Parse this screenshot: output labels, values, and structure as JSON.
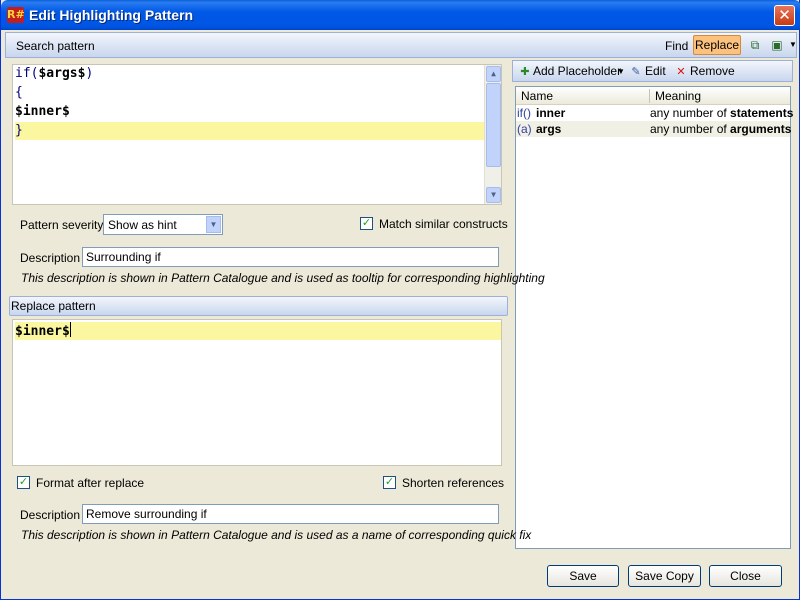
{
  "window": {
    "title": "Edit Highlighting Pattern",
    "app_icon": "R#"
  },
  "search": {
    "header_label": "Search pattern",
    "find_label": "Find",
    "replace_label": "Replace",
    "code": [
      "if($args$)",
      "{",
      "$inner$",
      "}"
    ],
    "severity_label": "Pattern severity",
    "severity_value": "Show as hint",
    "match_similar_label": "Match similar constructs",
    "description_label": "Description",
    "description_value": "Surrounding if",
    "description_hint": "This description is shown in Pattern Catalogue and is used as tooltip for corresponding highlighting"
  },
  "replace": {
    "header_label": "Replace pattern",
    "code": [
      "$inner$"
    ],
    "format_label": "Format after replace",
    "shorten_label": "Shorten references",
    "description_label": "Description",
    "description_value": "Remove surrounding if",
    "description_hint": "This description is shown in Pattern Catalogue and is used as a name of corresponding quick fix"
  },
  "placeholders": {
    "add_label": "Add Placeholder",
    "edit_label": "Edit",
    "remove_label": "Remove",
    "columns": [
      "Name",
      "Meaning"
    ],
    "rows": [
      {
        "icon": "if()",
        "name": "inner",
        "meaning_prefix": "any number of ",
        "meaning_bold": "statements"
      },
      {
        "icon": "(a)",
        "name": "args",
        "meaning_prefix": "any number of ",
        "meaning_bold": "arguments"
      }
    ]
  },
  "footer": {
    "save": "Save",
    "save_copy": "Save Copy",
    "close": "Close"
  },
  "colors": {
    "highlight": "#fbf6a0",
    "replace_active": "#fbc17d",
    "title_bar": "#0055e5"
  }
}
